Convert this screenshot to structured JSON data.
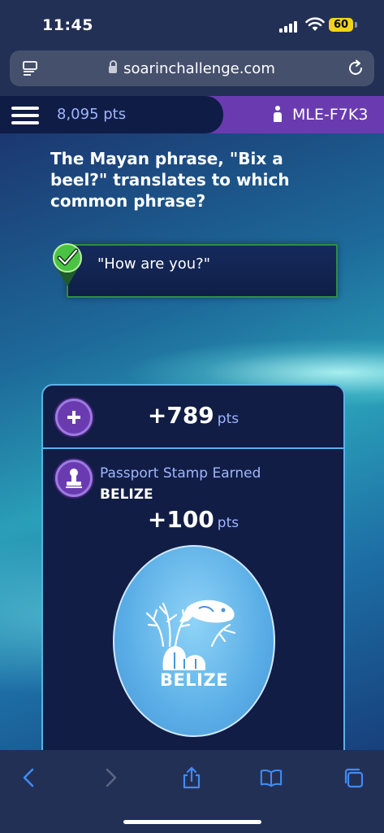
{
  "status_bar": {
    "time": "11:45",
    "battery": "60"
  },
  "browser": {
    "url": "soarinchallenge.com"
  },
  "game": {
    "points": "8,095 pts",
    "user_id": "MLE-F7K3",
    "question": "The Mayan phrase, \"Bix a beel?\" translates to which common phrase?",
    "answer": "\"How are you?\"",
    "bonus": {
      "value": "+789",
      "unit": "pts"
    },
    "stamp": {
      "title": "Passport Stamp Earned",
      "country": "BELIZE",
      "points": {
        "value": "+100",
        "unit": "pts"
      },
      "badge_label": "BELIZE"
    }
  },
  "icons": {
    "reader": "reader-icon",
    "lock": "lock-icon",
    "reload": "reload-icon",
    "menu": "menu-icon",
    "user": "user-icon",
    "check": "checkmark-icon",
    "plus": "plus-icon",
    "stamp": "stamp-icon",
    "back": "back-icon",
    "forward": "forward-icon",
    "share": "share-icon",
    "bookmarks": "bookmarks-icon",
    "tabs": "tabs-icon"
  },
  "colors": {
    "accent_purple": "#6a3bb0",
    "panel_dark": "#111d45",
    "link_blue": "#9fb6ff",
    "correct_green": "#2f8d3f"
  }
}
